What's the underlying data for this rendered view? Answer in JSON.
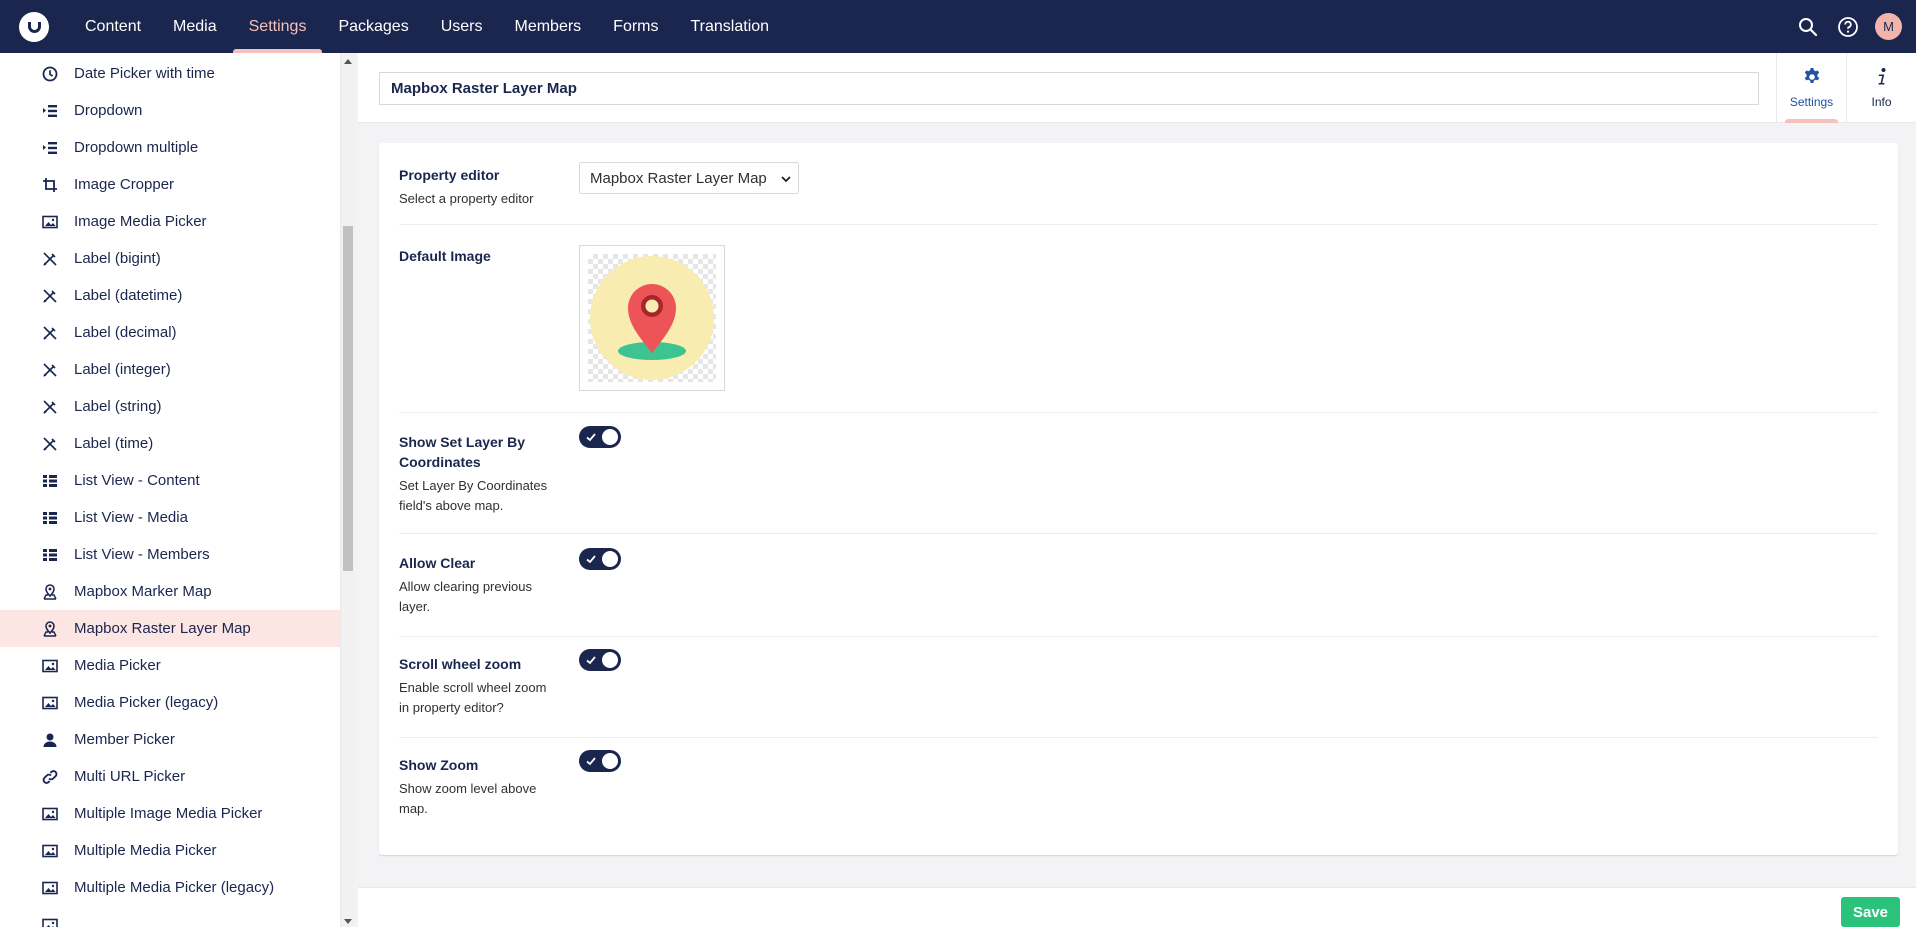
{
  "topbar": {
    "nav": [
      "Content",
      "Media",
      "Settings",
      "Packages",
      "Users",
      "Members",
      "Forms",
      "Translation"
    ],
    "active_nav": "Settings",
    "avatar_initial": "M"
  },
  "sidebar": {
    "items": [
      {
        "label": "Date Picker with time",
        "icon": "clock-icon"
      },
      {
        "label": "Dropdown",
        "icon": "list-icon"
      },
      {
        "label": "Dropdown multiple",
        "icon": "list-icon"
      },
      {
        "label": "Image Cropper",
        "icon": "crop-icon"
      },
      {
        "label": "Image Media Picker",
        "icon": "picture-icon"
      },
      {
        "label": "Label (bigint)",
        "icon": "readonly-icon"
      },
      {
        "label": "Label (datetime)",
        "icon": "readonly-icon"
      },
      {
        "label": "Label (decimal)",
        "icon": "readonly-icon"
      },
      {
        "label": "Label (integer)",
        "icon": "readonly-icon"
      },
      {
        "label": "Label (string)",
        "icon": "readonly-icon"
      },
      {
        "label": "Label (time)",
        "icon": "readonly-icon"
      },
      {
        "label": "List View - Content",
        "icon": "grid-list-icon"
      },
      {
        "label": "List View - Media",
        "icon": "grid-list-icon"
      },
      {
        "label": "List View - Members",
        "icon": "grid-list-icon"
      },
      {
        "label": "Mapbox Marker Map",
        "icon": "map-pin-icon"
      },
      {
        "label": "Mapbox Raster Layer Map",
        "icon": "map-pin-icon",
        "selected": true
      },
      {
        "label": "Media Picker",
        "icon": "picture-icon"
      },
      {
        "label": "Media Picker (legacy)",
        "icon": "picture-icon"
      },
      {
        "label": "Member Picker",
        "icon": "user-icon"
      },
      {
        "label": "Multi URL Picker",
        "icon": "link-icon"
      },
      {
        "label": "Multiple Image Media Picker",
        "icon": "picture-icon"
      },
      {
        "label": "Multiple Media Picker",
        "icon": "picture-icon"
      },
      {
        "label": "Multiple Media Picker (legacy)",
        "icon": "picture-icon"
      },
      {
        "label": "",
        "icon": "picture-icon"
      }
    ]
  },
  "header": {
    "name_value": "Mapbox Raster Layer Map",
    "apps": [
      {
        "label": "Settings",
        "icon": "gear-icon",
        "active": true
      },
      {
        "label": "Info",
        "icon": "info-icon",
        "active": false
      }
    ]
  },
  "properties": [
    {
      "label": "Property editor",
      "description": "Select a property editor",
      "type": "select",
      "value": "Mapbox Raster Layer Map"
    },
    {
      "label": "Default Image",
      "description": "",
      "type": "image",
      "value": "map-marker-image"
    },
    {
      "label": "Show Set Layer By Coordinates",
      "description": "Set Layer By Coordinates field's above map.",
      "type": "toggle",
      "value": true
    },
    {
      "label": "Allow Clear",
      "description": "Allow clearing previous layer.",
      "type": "toggle",
      "value": true
    },
    {
      "label": "Scroll wheel zoom",
      "description": "Enable scroll wheel zoom in property editor?",
      "type": "toggle",
      "value": true
    },
    {
      "label": "Show Zoom",
      "description": "Show zoom level above map.",
      "type": "toggle",
      "value": true
    }
  ],
  "footer": {
    "save_label": "Save"
  },
  "colors": {
    "topbar": "#1b264f",
    "accent": "#f5c1bc",
    "selected_row": "#fde5e3",
    "save": "#2bc37c"
  }
}
